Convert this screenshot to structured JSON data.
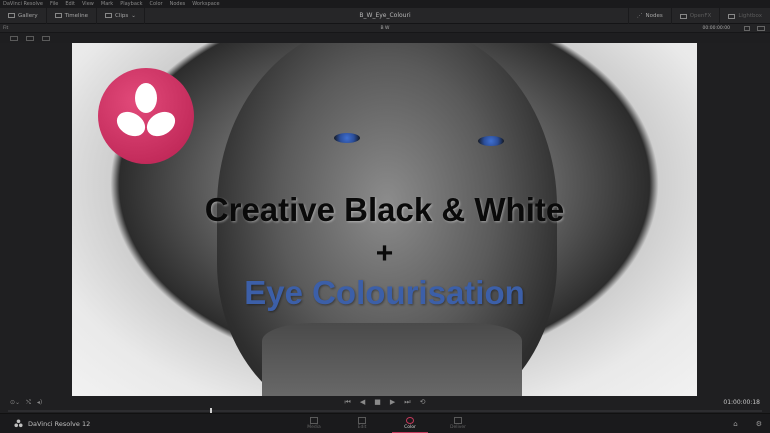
{
  "menubar": {
    "items": [
      "DaVinci Resolve",
      "File",
      "Edit",
      "View",
      "Mark",
      "Playback",
      "Color",
      "Nodes",
      "Workspace"
    ]
  },
  "toolbar": {
    "gallery": "Gallery",
    "timeline": "Timeline",
    "clips": "Clips",
    "project_title": "B_W_Eye_Colouri",
    "nodes": "Nodes",
    "openfx": "OpenFX",
    "lightbox": "Lightbox"
  },
  "subbar": {
    "selector": "Fit",
    "clip_name": "B W",
    "timecode": "00:00:00:00"
  },
  "overlay": {
    "line1": "Creative Black & White",
    "line2": "+",
    "line3": "Eye Colourisation"
  },
  "transport": {
    "timecode": "01:00:00:18"
  },
  "bottombar": {
    "app_name": "DaVinci Resolve 12",
    "pages": [
      {
        "label": "Media",
        "active": false
      },
      {
        "label": "Edit",
        "active": false
      },
      {
        "label": "Color",
        "active": true
      },
      {
        "label": "Deliver",
        "active": false
      }
    ]
  },
  "colors": {
    "accent": "#c73a5c",
    "logo": "#c92a5b",
    "overlay_blue": "#3c5fa8"
  }
}
